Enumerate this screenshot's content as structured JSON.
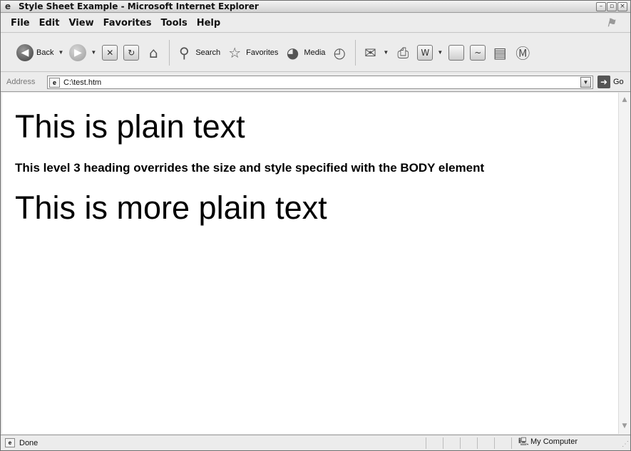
{
  "window": {
    "title": "Style Sheet Example - Microsoft Internet Explorer",
    "buttons": [
      "minimize",
      "maximize",
      "close"
    ]
  },
  "menu": {
    "items": [
      "File",
      "Edit",
      "View",
      "Favorites",
      "Tools",
      "Help"
    ]
  },
  "toolbar": {
    "back_label": "Back",
    "search_label": "Search",
    "favorites_label": "Favorites",
    "media_label": "Media",
    "icons": [
      "back-icon",
      "forward-icon",
      "stop-icon",
      "refresh-icon",
      "home-icon",
      "search-icon",
      "favorites-icon",
      "media-icon",
      "history-icon",
      "mail-icon",
      "print-icon",
      "edit-icon",
      "discuss-icon",
      "messenger-icon",
      "research-icon",
      "msn-icon"
    ]
  },
  "address": {
    "label": "Address",
    "value": "C:\\test.htm",
    "go_label": "Go"
  },
  "content": {
    "plain_text_1": "This is plain text",
    "heading_3": "This level 3 heading overrides the size and style specified with the BODY element",
    "plain_text_2": "This is more plain text"
  },
  "status": {
    "text": "Done",
    "zone": "My Computer"
  }
}
